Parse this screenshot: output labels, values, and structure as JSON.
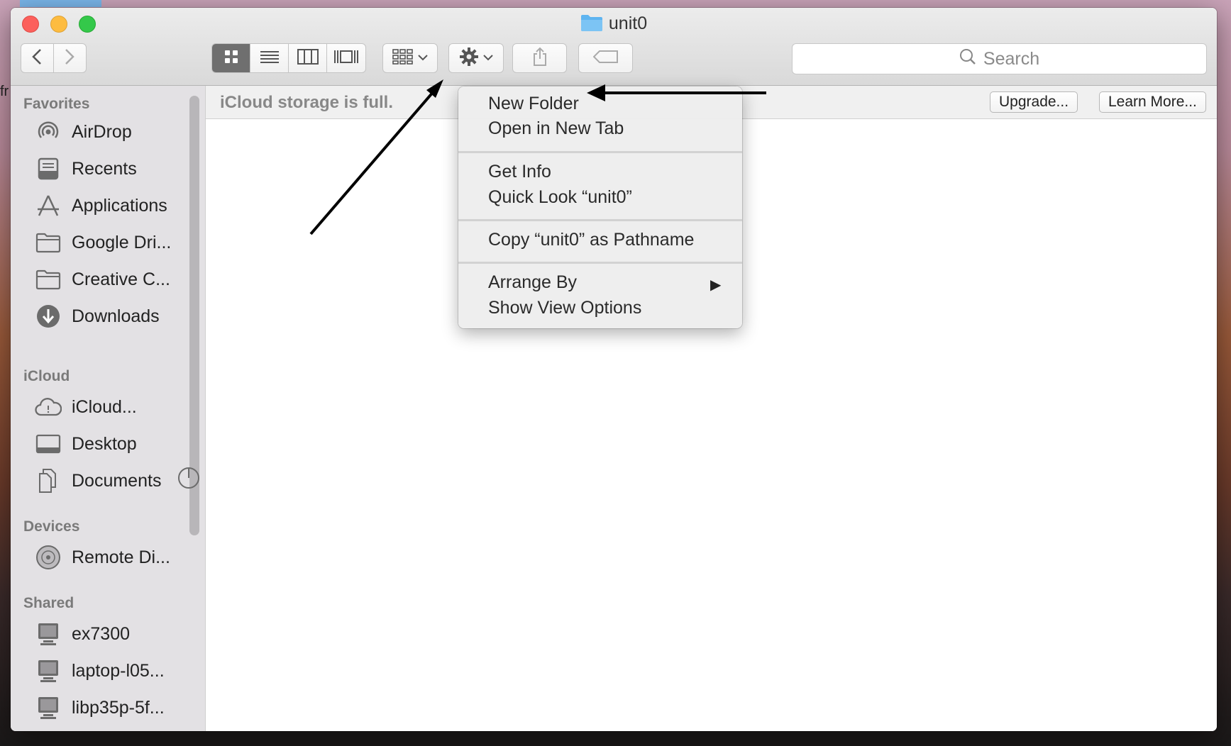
{
  "window": {
    "title": "unit0",
    "folder_icon": "folder-icon"
  },
  "desktop": {
    "edge_text": "fr"
  },
  "toolbar": {
    "back_icon": "chevron-left-icon",
    "forward_icon": "chevron-right-icon",
    "view_modes": [
      "icon-view",
      "list-view",
      "column-view",
      "cover-flow-view"
    ],
    "active_view": "icon-view",
    "group_icon": "group-by-icon",
    "action_icon": "gear-icon",
    "share_icon": "share-icon",
    "tag_icon": "tag-icon",
    "search_placeholder": "Search"
  },
  "sidebar": {
    "sections": {
      "favorites": "Favorites",
      "icloud": "iCloud",
      "devices": "Devices",
      "shared": "Shared"
    },
    "favorites": [
      {
        "label": "AirDrop",
        "icon": "airdrop-icon"
      },
      {
        "label": "Recents",
        "icon": "recents-icon"
      },
      {
        "label": "Applications",
        "icon": "applications-icon"
      },
      {
        "label": "Google Dri...",
        "icon": "folder-icon"
      },
      {
        "label": "Creative C...",
        "icon": "folder-icon"
      },
      {
        "label": "Downloads",
        "icon": "downloads-icon"
      }
    ],
    "icloud": [
      {
        "label": "iCloud...",
        "icon": "icloud-icon"
      },
      {
        "label": "Desktop",
        "icon": "desktop-icon"
      },
      {
        "label": "Documents",
        "icon": "documents-icon"
      }
    ],
    "devices": [
      {
        "label": "Remote Di...",
        "icon": "disc-icon"
      }
    ],
    "shared": [
      {
        "label": "ex7300",
        "icon": "computer-icon"
      },
      {
        "label": "laptop-l05...",
        "icon": "computer-icon"
      },
      {
        "label": "libp35p-5f...",
        "icon": "computer-icon"
      }
    ]
  },
  "banner": {
    "message": "iCloud storage is full.",
    "upgrade_label": "Upgrade...",
    "learn_more_label": "Learn More..."
  },
  "context_menu": {
    "items": [
      "New Folder",
      "Open in New Tab",
      "Get Info",
      "Quick Look “unit0”",
      "Copy “unit0” as Pathname",
      "Arrange By",
      "Show View Options"
    ],
    "submenu_arrow": "▶"
  },
  "colors": {
    "close": "#fc605c",
    "minimize": "#fdbc40",
    "maximize": "#34c84a",
    "sidebar_bg": "#e3e1e4",
    "folder_blue": "#5eb4f0"
  }
}
